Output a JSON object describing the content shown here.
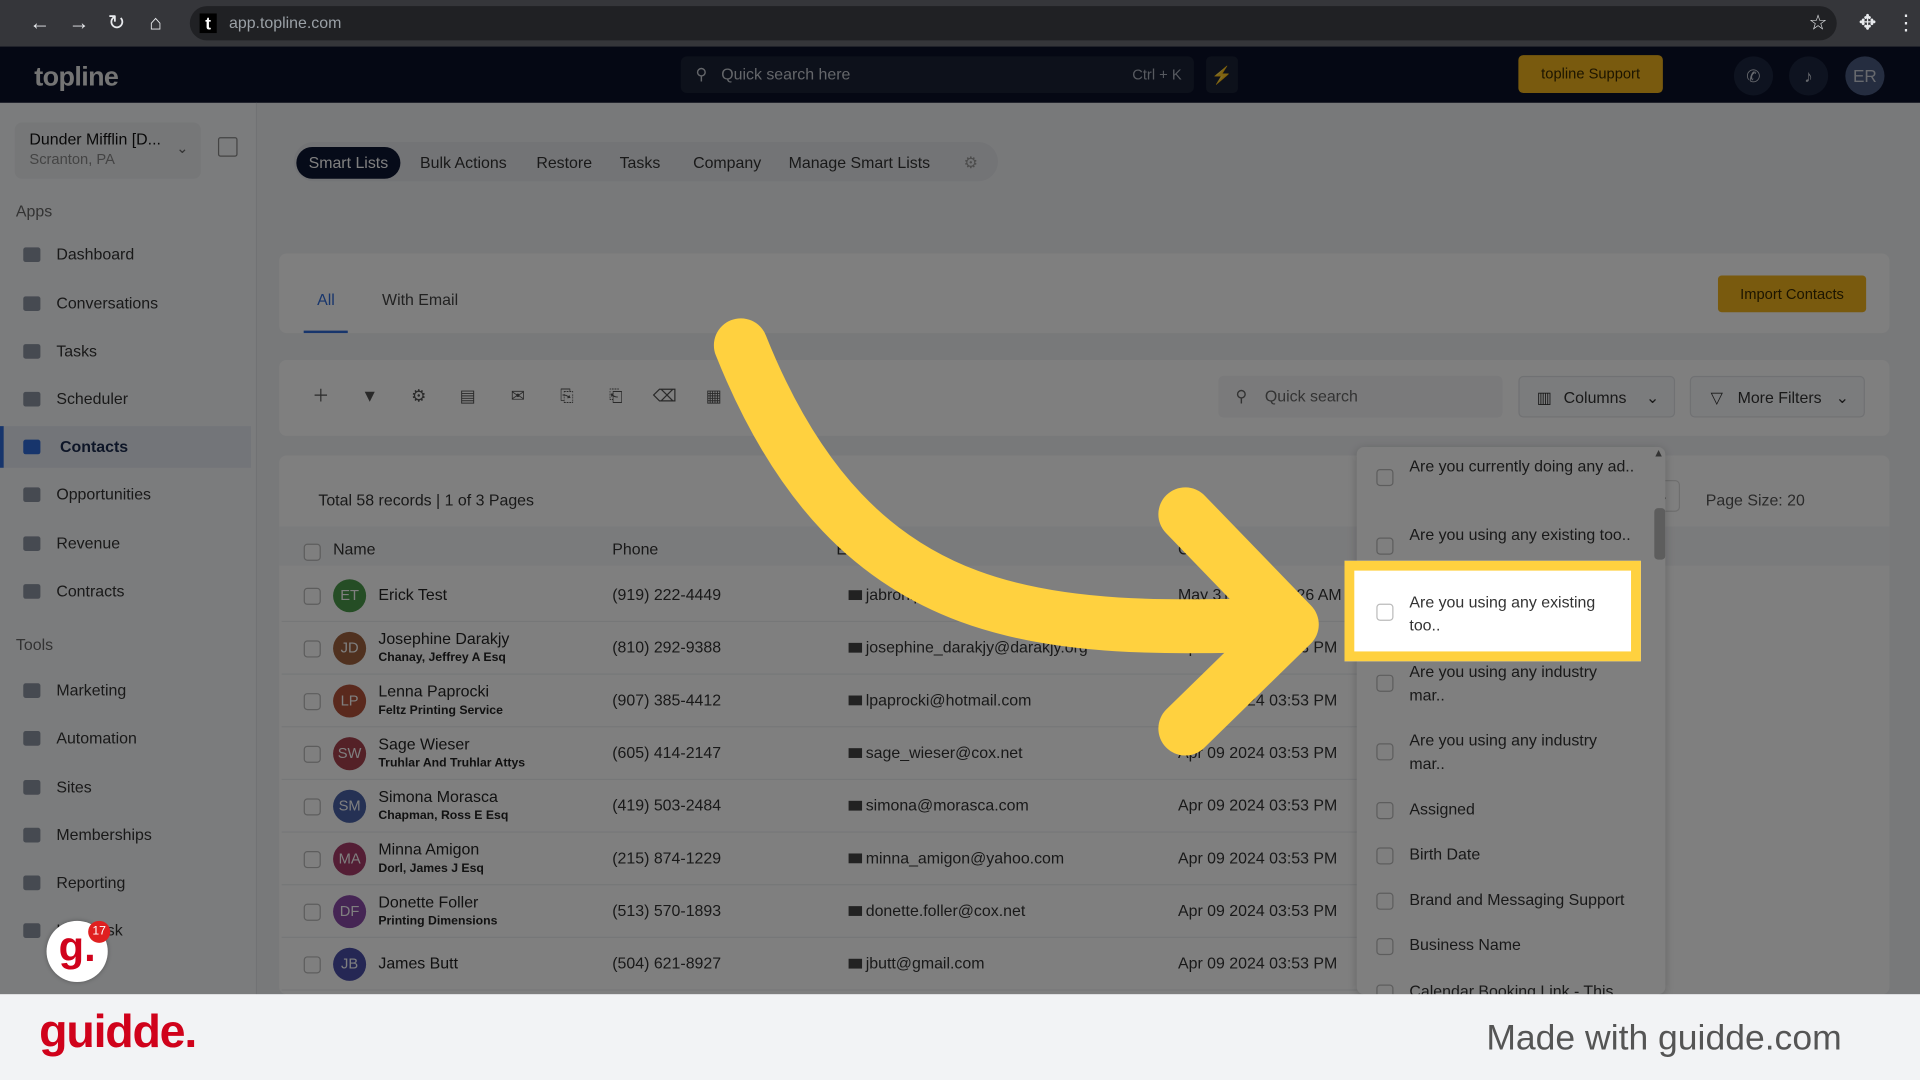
{
  "browser": {
    "url": "app.topline.com",
    "favicon": "t"
  },
  "header": {
    "logo": "topline",
    "search_placeholder": "Quick search here",
    "shortcut": "Ctrl + K",
    "support_label": "topline Support",
    "avatar": "ER"
  },
  "sidebar": {
    "org_name": "Dunder Mifflin [D...",
    "org_location": "Scranton, PA",
    "apps_label": "Apps",
    "tools_label": "Tools",
    "apps": [
      {
        "label": "Dashboard"
      },
      {
        "label": "Conversations"
      },
      {
        "label": "Tasks"
      },
      {
        "label": "Scheduler"
      },
      {
        "label": "Contacts",
        "active": true
      },
      {
        "label": "Opportunities"
      },
      {
        "label": "Revenue"
      },
      {
        "label": "Contracts"
      }
    ],
    "tools": [
      {
        "label": "Marketing"
      },
      {
        "label": "Automation"
      },
      {
        "label": "Sites"
      },
      {
        "label": "Memberships"
      },
      {
        "label": "Reporting"
      },
      {
        "label": "Helpdesk"
      }
    ]
  },
  "nav": {
    "pills": [
      "Smart Lists",
      "Bulk Actions",
      "Restore",
      "Tasks",
      "Company",
      "Manage Smart Lists"
    ],
    "active": "Smart Lists"
  },
  "tabs": {
    "all": "All",
    "with_email": "With Email",
    "import_label": "Import Contacts"
  },
  "toolbar": {
    "quick_search": "Quick search",
    "columns": "Columns",
    "more_filters": "More Filters"
  },
  "table": {
    "summary": "Total 58 records | 1 of 3 Pages",
    "page_size": "Page Size: 20",
    "headers": {
      "name": "Name",
      "phone": "Phone",
      "email": "Em",
      "created": "C"
    },
    "rows": [
      {
        "initials": "ET",
        "color": "#4a9a4a",
        "name": "Erick Test",
        "company": "",
        "phone": "(919) 222-4449",
        "email": "jabronip",
        "date": "May 31 2024 03:26 AM"
      },
      {
        "initials": "JD",
        "color": "#a0633e",
        "name": "Josephine Darakjy",
        "company": "Chanay, Jeffrey A Esq",
        "phone": "(810) 292-9388",
        "email": "josephine_darakjy@darakjy.org",
        "date": "Apr 09 2024 03:53 PM"
      },
      {
        "initials": "LP",
        "color": "#b5523b",
        "name": "Lenna Paprocki",
        "company": "Feltz Printing Service",
        "phone": "(907) 385-4412",
        "email": "lpaprocki@hotmail.com",
        "date": "Apr 09 2024 03:53 PM"
      },
      {
        "initials": "SW",
        "color": "#a8424f",
        "name": "Sage Wieser",
        "company": "Truhlar And Truhlar Attys",
        "phone": "(605) 414-2147",
        "email": "sage_wieser@cox.net",
        "date": "Apr 09 2024 03:53 PM"
      },
      {
        "initials": "SM",
        "color": "#4a63a8",
        "name": "Simona Morasca",
        "company": "Chapman, Ross E Esq",
        "phone": "(419) 503-2484",
        "email": "simona@morasca.com",
        "date": "Apr 09 2024 03:53 PM"
      },
      {
        "initials": "MA",
        "color": "#a83c6a",
        "name": "Minna Amigon",
        "company": "Dorl, James J Esq",
        "phone": "(215) 874-1229",
        "email": "minna_amigon@yahoo.com",
        "date": "Apr 09 2024 03:53 PM"
      },
      {
        "initials": "DF",
        "color": "#8a4aa8",
        "name": "Donette Foller",
        "company": "Printing Dimensions",
        "phone": "(513) 570-1893",
        "email": "donette.foller@cox.net",
        "date": "Apr 09 2024 03:53 PM"
      },
      {
        "initials": "JB",
        "color": "#4a4fa8",
        "name": "James Butt",
        "company": "",
        "phone": "(504) 621-8927",
        "email": "jbutt@gmail.com",
        "date": "Apr 09 2024 03:53 PM"
      }
    ]
  },
  "columns_dropdown": {
    "items": [
      "Are you currently doing any ad..",
      "Are you using any existing too..",
      "Are you using any existing too..",
      "Are you using any industry mar..",
      "Are you using any industry mar..",
      "Assigned",
      "Birth Date",
      "Brand and Messaging Support",
      "Business Name",
      "Calendar Booking Link - This"
    ],
    "highlighted_index": 2
  },
  "footer": {
    "logo": "guidde.",
    "made_with": "Made with guidde.com",
    "badge_count": "17"
  },
  "colors": {
    "accent": "#ffd13f",
    "brand_red": "#d0021b",
    "header": "#0a1128",
    "button": "#f2b51c"
  }
}
